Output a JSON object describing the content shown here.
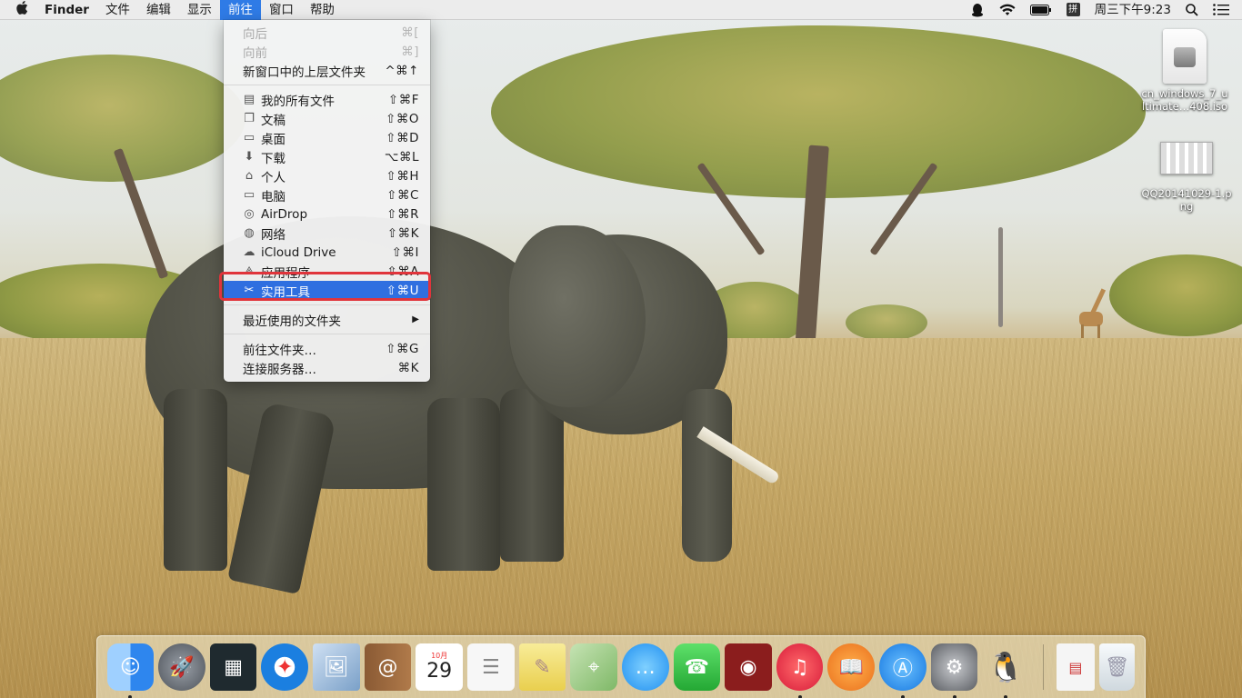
{
  "menubar": {
    "apple": "",
    "app_name": "Finder",
    "menus": [
      "文件",
      "编辑",
      "显示",
      "前往",
      "窗口",
      "帮助"
    ],
    "active_menu_index": 3,
    "clock": "周三下午9:23",
    "ime_label": "拼"
  },
  "go_menu": {
    "items": [
      {
        "label": "向后",
        "shortcut": "⌘[",
        "disabled": true,
        "icon": ""
      },
      {
        "label": "向前",
        "shortcut": "⌘]",
        "disabled": true,
        "icon": ""
      },
      {
        "label": "新窗口中的上层文件夹",
        "shortcut": "^⌘↑",
        "disabled": false,
        "icon": ""
      },
      {
        "label": "我的所有文件",
        "shortcut": "⇧⌘F",
        "icon": "all-files-icon"
      },
      {
        "label": "文稿",
        "shortcut": "⇧⌘O",
        "icon": "documents-icon"
      },
      {
        "label": "桌面",
        "shortcut": "⇧⌘D",
        "icon": "desktop-icon"
      },
      {
        "label": "下载",
        "shortcut": "⌥⌘L",
        "icon": "downloads-icon"
      },
      {
        "label": "个人",
        "shortcut": "⇧⌘H",
        "icon": "home-icon"
      },
      {
        "label": "电脑",
        "shortcut": "⇧⌘C",
        "icon": "computer-icon"
      },
      {
        "label": "AirDrop",
        "shortcut": "⇧⌘R",
        "icon": "airdrop-icon"
      },
      {
        "label": "网络",
        "shortcut": "⇧⌘K",
        "icon": "network-icon"
      },
      {
        "label": "iCloud Drive",
        "shortcut": "⇧⌘I",
        "icon": "icloud-icon"
      },
      {
        "label": "应用程序",
        "shortcut": "⇧⌘A",
        "icon": "applications-icon"
      },
      {
        "label": "实用工具",
        "shortcut": "⇧⌘U",
        "icon": "utilities-icon",
        "highlighted": true
      },
      {
        "label": "最近使用的文件夹",
        "submenu": true
      },
      {
        "label": "前往文件夹…",
        "shortcut": "⇧⌘G"
      },
      {
        "label": "连接服务器…",
        "shortcut": "⌘K"
      }
    ]
  },
  "desktop_files": [
    {
      "name": "cn_windows_7_ultimate…408.iso",
      "line1": "cn_windows_7_u",
      "line2": "ltimate…408.iso"
    },
    {
      "name": "QQ20141029-1.png",
      "line1": "QQ20141029-1.p",
      "line2": "ng"
    }
  ],
  "dock": {
    "apps": [
      {
        "name": "finder",
        "running": true,
        "color": "#3b8ff0"
      },
      {
        "name": "launchpad",
        "running": false,
        "color": "#6b6f78"
      },
      {
        "name": "mission-control",
        "running": false,
        "color": "#1f2a2f"
      },
      {
        "name": "safari",
        "running": false,
        "color": "#1b7fe0"
      },
      {
        "name": "preview",
        "running": false,
        "color": "#7aa0c8"
      },
      {
        "name": "contacts",
        "running": false,
        "color": "#b07a4a"
      },
      {
        "name": "calendar",
        "running": false,
        "month": "10月",
        "day": "29"
      },
      {
        "name": "reminders",
        "running": false,
        "color": "#f4f4f4"
      },
      {
        "name": "notes",
        "running": false,
        "color": "#f6e27a"
      },
      {
        "name": "maps",
        "running": false,
        "color": "#7fb867"
      },
      {
        "name": "messages",
        "running": false,
        "color": "#35a8f5"
      },
      {
        "name": "facetime",
        "running": false,
        "color": "#3cbe4a"
      },
      {
        "name": "photo-booth",
        "running": false,
        "color": "#8b1d1d"
      },
      {
        "name": "itunes",
        "running": true,
        "color": "#e8253a"
      },
      {
        "name": "ibooks",
        "running": false,
        "color": "#f0851c"
      },
      {
        "name": "app-store",
        "running": true,
        "color": "#2a8cf0"
      },
      {
        "name": "system-preferences",
        "running": true,
        "color": "#7d7f84"
      },
      {
        "name": "qq",
        "running": true,
        "color": "#222"
      }
    ],
    "right": [
      {
        "name": "document",
        "color": "#f5f5f5"
      },
      {
        "name": "trash",
        "color": "#e8eef2"
      }
    ]
  }
}
